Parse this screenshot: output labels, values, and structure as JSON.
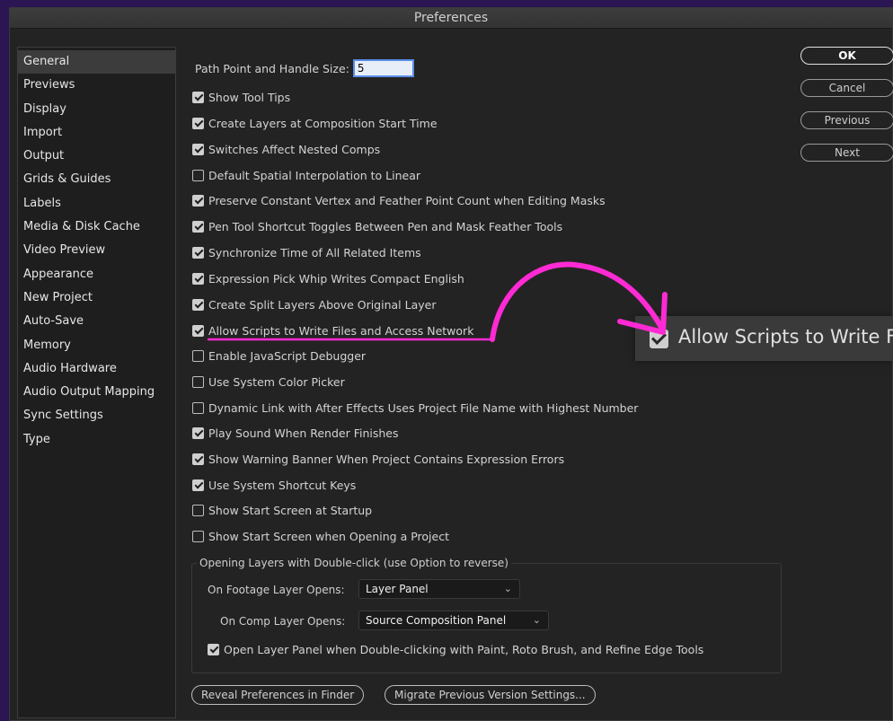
{
  "window": {
    "title": "Preferences"
  },
  "sidebar": {
    "items": [
      {
        "label": "General",
        "active": true
      },
      {
        "label": "Previews"
      },
      {
        "label": "Display"
      },
      {
        "label": "Import"
      },
      {
        "label": "Output"
      },
      {
        "label": "Grids & Guides"
      },
      {
        "label": "Labels"
      },
      {
        "label": "Media & Disk Cache"
      },
      {
        "label": "Video Preview"
      },
      {
        "label": "Appearance"
      },
      {
        "label": "New Project"
      },
      {
        "label": "Auto-Save"
      },
      {
        "label": "Memory"
      },
      {
        "label": "Audio Hardware"
      },
      {
        "label": "Audio Output Mapping"
      },
      {
        "label": "Sync Settings"
      },
      {
        "label": "Type"
      }
    ]
  },
  "buttons": {
    "ok": "OK",
    "cancel": "Cancel",
    "previous": "Previous",
    "next": "Next"
  },
  "general": {
    "path_point_label": "Path Point and Handle Size:",
    "path_point_value": "5",
    "options": [
      {
        "label": "Show Tool Tips",
        "checked": true
      },
      {
        "label": "Create Layers at Composition Start Time",
        "checked": true
      },
      {
        "label": "Switches Affect Nested Comps",
        "checked": true
      },
      {
        "label": "Default Spatial Interpolation to Linear",
        "checked": false
      },
      {
        "label": "Preserve Constant Vertex and Feather Point Count when Editing Masks",
        "checked": true
      },
      {
        "label": "Pen Tool Shortcut Toggles Between Pen and Mask Feather Tools",
        "checked": true
      },
      {
        "label": "Synchronize Time of All Related Items",
        "checked": true
      },
      {
        "label": "Expression Pick Whip Writes Compact English",
        "checked": true
      },
      {
        "label": "Create Split Layers Above Original Layer",
        "checked": true
      },
      {
        "label": "Allow Scripts to Write Files and Access Network",
        "checked": true
      },
      {
        "label": "Enable JavaScript Debugger",
        "checked": false
      },
      {
        "label": "Use System Color Picker",
        "checked": false
      },
      {
        "label": "Dynamic Link with After Effects Uses Project File Name with Highest Number",
        "checked": false
      },
      {
        "label": "Play Sound When Render Finishes",
        "checked": true
      },
      {
        "label": "Show Warning Banner When Project Contains Expression Errors",
        "checked": true
      },
      {
        "label": "Use System Shortcut Keys",
        "checked": true
      },
      {
        "label": "Show Start Screen at Startup",
        "checked": false
      },
      {
        "label": "Show Start Screen when Opening a Project",
        "checked": false
      }
    ],
    "double_click_group": {
      "title": "Opening Layers with Double-click (use Option to reverse)",
      "footage_label": "On Footage Layer Opens:",
      "footage_value": "Layer Panel",
      "comp_label": "On Comp Layer Opens:",
      "comp_value": "Source Composition Panel",
      "paint_option": {
        "label": "Open Layer Panel when Double-clicking with Paint, Roto Brush, and Refine Edge Tools",
        "checked": true
      }
    },
    "reveal_button": "Reveal Preferences in Finder",
    "migrate_button": "Migrate Previous Version Settings..."
  },
  "callout": {
    "text": "Allow Scripts to Write F",
    "checked": true
  },
  "colors": {
    "annotation": "#ff2ad4",
    "background": "#2b1552",
    "panel": "#232323"
  }
}
